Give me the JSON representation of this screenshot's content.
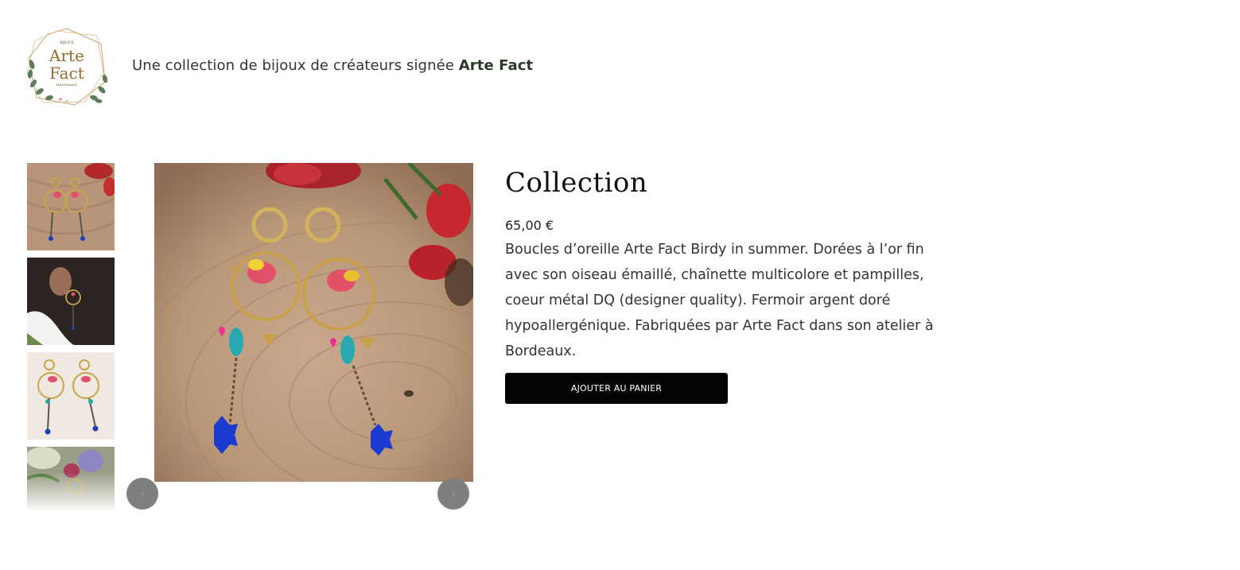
{
  "header": {
    "logo_top_text": "BIJOUX",
    "logo_main_line1": "Arte",
    "logo_main_line2": "Fact",
    "logo_bottom_text": "HANDMADE",
    "tagline_prefix": "Une collection de bijoux de créateurs signée ",
    "tagline_brand": "Arte Fact"
  },
  "gallery": {
    "thumbnails": [
      {
        "icon": "earrings-on-wood-thumb"
      },
      {
        "icon": "earring-worn-thumb"
      },
      {
        "icon": "earrings-on-white-thumb"
      },
      {
        "icon": "earrings-with-flowers-thumb"
      }
    ],
    "prev_label": "‹",
    "next_label": "›"
  },
  "product": {
    "title": "Collection",
    "price": "65,00 €",
    "description": "Boucles d’oreille Arte Fact Birdy in summer. Dorées à l’or fin avec son oiseau émaillé, chaînette multicolore et pampilles, coeur métal DQ (designer quality). Fermoir argent doré hypoallergénique. Fabriquées par Arte Fact dans son atelier à Bordeaux.",
    "add_to_cart": "AJOUTER AU PANIER"
  },
  "colors": {
    "button": "#050505",
    "brand_gold": "#9a6a2a",
    "leaf_green": "#4e6e4e"
  }
}
